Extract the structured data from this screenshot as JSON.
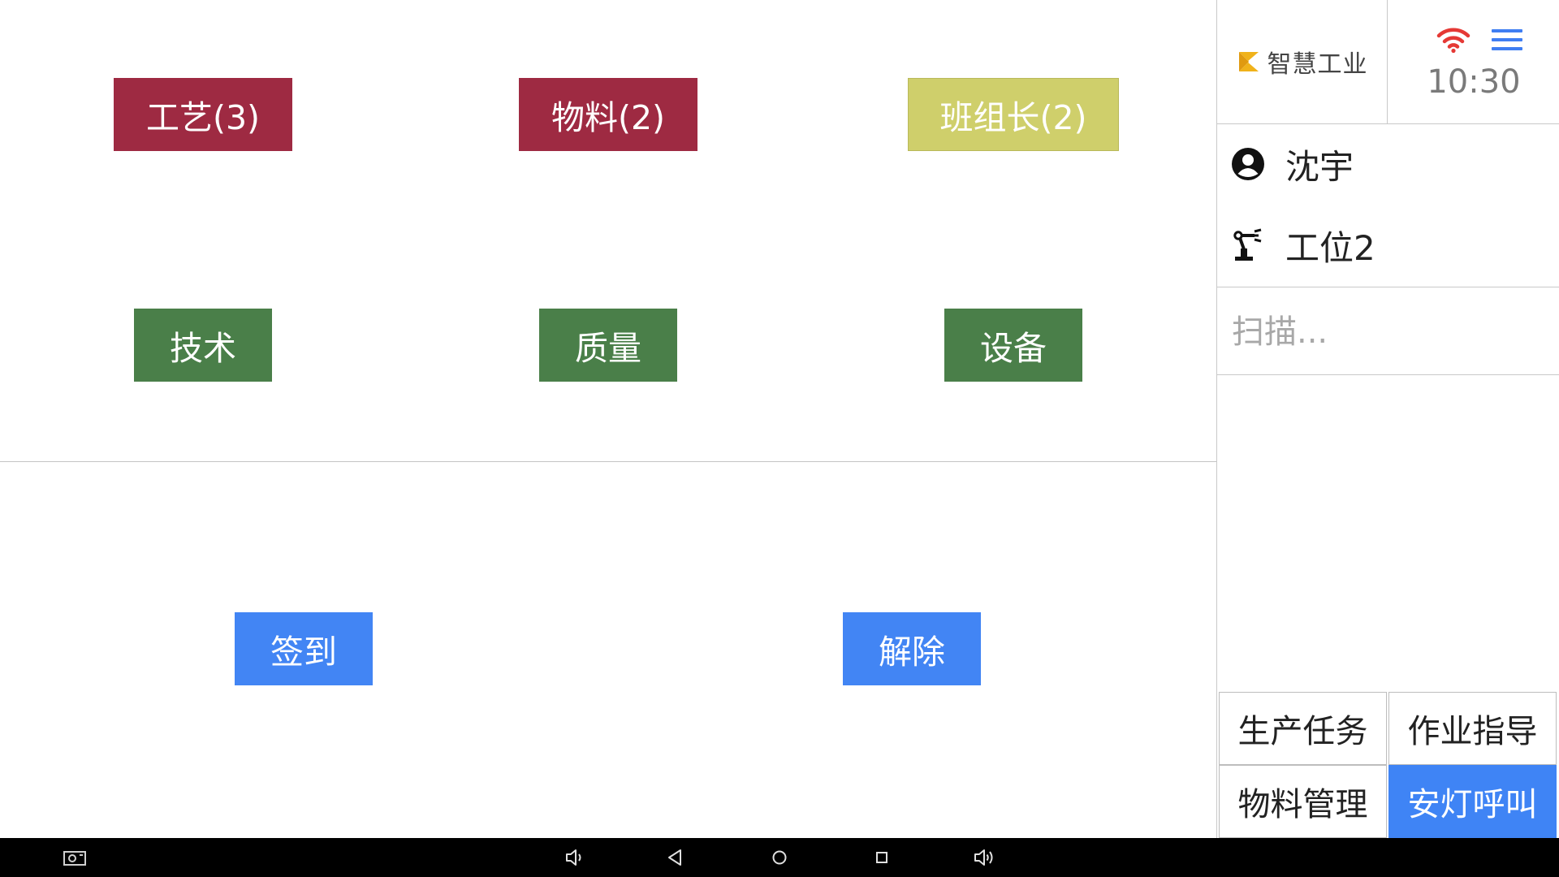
{
  "calls": {
    "craft": {
      "label": "工艺(3)",
      "color": "#9e2a42"
    },
    "material": {
      "label": "物料(2)",
      "color": "#9e2a42"
    },
    "team_leader": {
      "label": "班组长(2)",
      "color": "#cfcf6b"
    },
    "technical": {
      "label": "技术",
      "color": "#4a7f49"
    },
    "quality": {
      "label": "质量",
      "color": "#4a7f49"
    },
    "equipment": {
      "label": "设备",
      "color": "#4a7f49"
    }
  },
  "actions": {
    "sign_in": {
      "label": "签到",
      "color": "#4285f4"
    },
    "release": {
      "label": "解除",
      "color": "#4285f4"
    }
  },
  "brand": {
    "name": "智慧工业",
    "logo": "k-logo-icon",
    "logo_color": "#f0b21a"
  },
  "status": {
    "time": "10:30",
    "wifi_icon": "wifi-icon",
    "wifi_color": "#e53935",
    "menu_icon": "menu-icon",
    "menu_color": "#3f7ef2"
  },
  "user": {
    "name": "沈宇",
    "icon": "user-circle-icon"
  },
  "station": {
    "name": "工位2",
    "icon": "robot-arm-icon"
  },
  "scan": {
    "placeholder": "扫描..."
  },
  "nav": {
    "production_tasks": "生产任务",
    "work_guidance": "作业指导",
    "material_management": "物料管理",
    "andon_call": "安灯呼叫",
    "active": "安灯呼叫"
  },
  "system_bar": {
    "icons": [
      "screenshot-icon",
      "volume-down-icon",
      "back-icon",
      "home-icon",
      "recents-icon",
      "volume-up-icon"
    ]
  }
}
